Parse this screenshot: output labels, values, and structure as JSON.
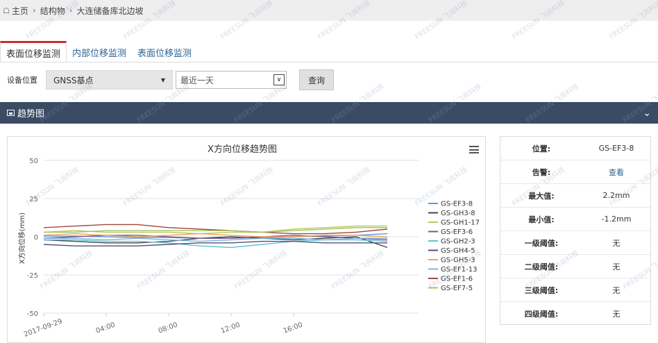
{
  "breadcrumb": {
    "home": "主页",
    "level1": "结构物",
    "level2": "大连储备库北边坡"
  },
  "tabs": [
    {
      "label": "表面位移监测",
      "active": true
    },
    {
      "label": "内部位移监测",
      "active": false
    },
    {
      "label": "表面位移监测",
      "active": false
    }
  ],
  "filter": {
    "device_label": "设备位置",
    "device_value": "GNSS基点",
    "range_value": "最近一天",
    "query_label": "查询"
  },
  "panel": {
    "title": "趋势图"
  },
  "info": [
    {
      "key": "位置:",
      "value": "GS-EF3-8",
      "link": false
    },
    {
      "key": "告警:",
      "value": "查看",
      "link": true
    },
    {
      "key": "最大值:",
      "value": "2.2mm",
      "link": false
    },
    {
      "key": "最小值:",
      "value": "-1.2mm",
      "link": false
    },
    {
      "key": "一级阈值:",
      "value": "无",
      "link": false
    },
    {
      "key": "二级阈值:",
      "value": "无",
      "link": false
    },
    {
      "key": "三级阈值:",
      "value": "无",
      "link": false
    },
    {
      "key": "四级阈值:",
      "value": "无",
      "link": false
    }
  ],
  "watermark": "FREESUN 飞尚科技",
  "chart_data": {
    "type": "line",
    "title": "X方向位移趋势图",
    "ylabel": "X方向位移(mm)",
    "ylim": [
      -50,
      50
    ],
    "yticks": [
      50,
      25,
      0,
      -25,
      -50
    ],
    "xlim": [
      0,
      24
    ],
    "xtick_values": [
      0,
      4,
      8,
      12,
      16
    ],
    "xtick_labels": [
      "2017-09-29",
      "04:00",
      "08:00",
      "12:00",
      "16:00"
    ],
    "legend_position": "right",
    "x": [
      0,
      2,
      4,
      6,
      8,
      10,
      12,
      14,
      16,
      18,
      20,
      22
    ],
    "series": [
      {
        "name": "GS-EF3-8",
        "color": "#5b9bd5",
        "values": [
          0.5,
          0.5,
          0,
          -0.5,
          -0.5,
          -1,
          -1,
          -0.5,
          0,
          0.5,
          1,
          2
        ]
      },
      {
        "name": "GS-GH3-8",
        "color": "#434348",
        "values": [
          -2,
          -3,
          -4,
          -4,
          -3,
          -1,
          0,
          -1,
          -2,
          -1,
          0,
          -7
        ]
      },
      {
        "name": "GS-GH1-17",
        "color": "#b5c95a",
        "values": [
          3,
          4,
          3,
          3,
          3,
          2,
          3,
          3,
          5,
          6,
          7,
          7
        ]
      },
      {
        "name": "GS-EF3-6",
        "color": "#7a5a8a",
        "values": [
          -1,
          0,
          1,
          1,
          0,
          -1,
          -1,
          0,
          1,
          0,
          -1,
          -2
        ]
      },
      {
        "name": "GS-GH2-3",
        "color": "#5fc1d6",
        "values": [
          -2,
          -2,
          -3,
          -3,
          -4,
          -6,
          -7,
          -5,
          -3,
          -2,
          -2,
          -3
        ]
      },
      {
        "name": "GS-GH4-5",
        "color": "#544e73",
        "values": [
          -5,
          -6,
          -6,
          -6,
          -5,
          -4,
          -4,
          -3,
          -3,
          -4,
          -4,
          -4
        ]
      },
      {
        "name": "GS-GH5-3",
        "color": "#f0a35a",
        "values": [
          1,
          2,
          1,
          0,
          1,
          2,
          1,
          0,
          0,
          1,
          1,
          0
        ]
      },
      {
        "name": "GS-EF1-13",
        "color": "#7fb2de",
        "values": [
          -1,
          -1,
          -2,
          -1,
          -2,
          -3,
          -2,
          -1,
          -1,
          -2,
          -1,
          -1
        ]
      },
      {
        "name": "GS-EF1-6",
        "color": "#a0483e",
        "values": [
          6,
          7,
          8,
          8,
          6,
          5,
          4,
          3,
          2,
          2,
          3,
          5
        ]
      },
      {
        "name": "GS-EF7-5",
        "color": "#a5c263",
        "values": [
          3,
          3,
          4,
          4,
          4,
          4,
          4,
          3,
          4,
          5,
          6,
          6
        ]
      }
    ]
  }
}
